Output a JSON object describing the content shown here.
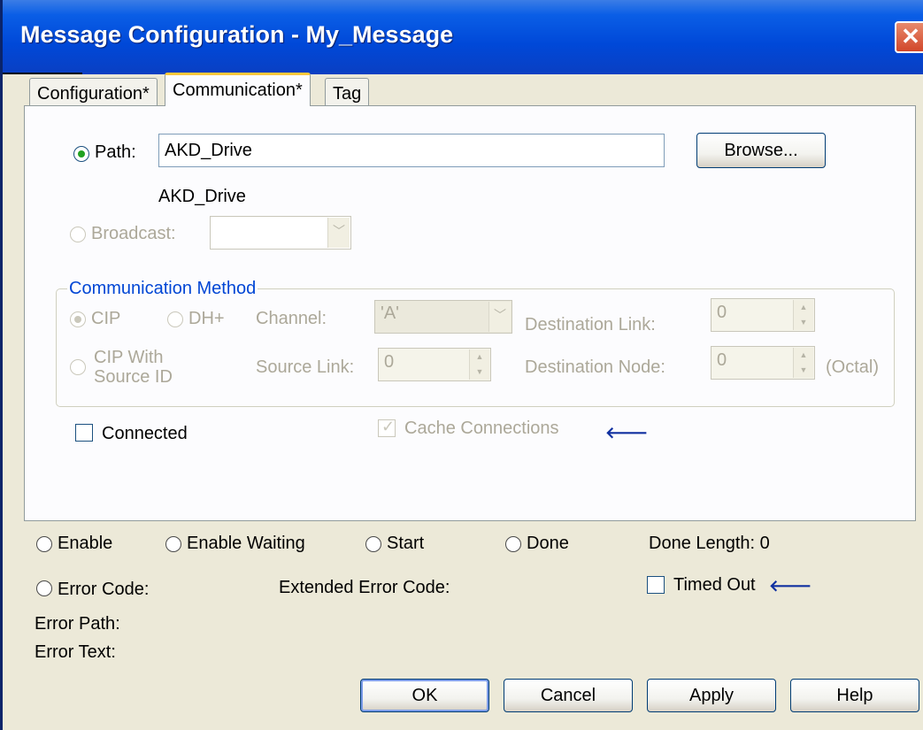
{
  "window": {
    "title": "Message Configuration - My_Message",
    "close_glyph": "✕"
  },
  "tabs": [
    {
      "label": "Configuration*",
      "active": false
    },
    {
      "label": "Communication*",
      "active": true
    },
    {
      "label": "Tag",
      "active": false
    }
  ],
  "communication": {
    "path_label": "Path:",
    "path_value": "AKD_Drive",
    "path_display": "AKD_Drive",
    "browse_label": "Browse...",
    "broadcast_label": "Broadcast:",
    "broadcast_value": "",
    "method": {
      "group_label": "Communication Method",
      "cip_label": "CIP",
      "dhplus_label": "DH+",
      "cip_source_line1": "CIP With",
      "cip_source_line2": "Source ID",
      "channel_label": "Channel:",
      "channel_value": "'A'",
      "destination_link_label": "Destination Link:",
      "destination_link_value": "0",
      "source_link_label": "Source Link:",
      "source_link_value": "0",
      "destination_node_label": "Destination Node:",
      "destination_node_value": "0",
      "octal_label": "(Octal)"
    },
    "connected_label": "Connected",
    "connected_checked": false,
    "cache_label": "Cache Connections",
    "cache_checked": true,
    "cache_arrow": "🡐"
  },
  "status": {
    "enable_label": "Enable",
    "enable_waiting_label": "Enable Waiting",
    "start_label": "Start",
    "done_label": "Done",
    "done_length_label": "Done Length: 0",
    "error_code_label": "Error Code:",
    "extended_error_label": "Extended Error Code:",
    "timed_out_label": "Timed Out",
    "timed_out_arrow": "🡐",
    "error_path_label": "Error Path:",
    "error_text_label": "Error Text:"
  },
  "buttons": {
    "ok": "OK",
    "cancel": "Cancel",
    "apply": "Apply",
    "help": "Help"
  },
  "icons": {
    "radio_selected": "radio-selected-icon",
    "checkmark": "✓",
    "dropdown": "chevron-down-icon",
    "spin": "spin-updown-icon"
  },
  "colors": {
    "titlebar": "#0048d8",
    "window_bg": "#ece9d8",
    "group_label": "#0046d5",
    "disabled_text": "#aca899",
    "radio_dot": "#21a121"
  }
}
